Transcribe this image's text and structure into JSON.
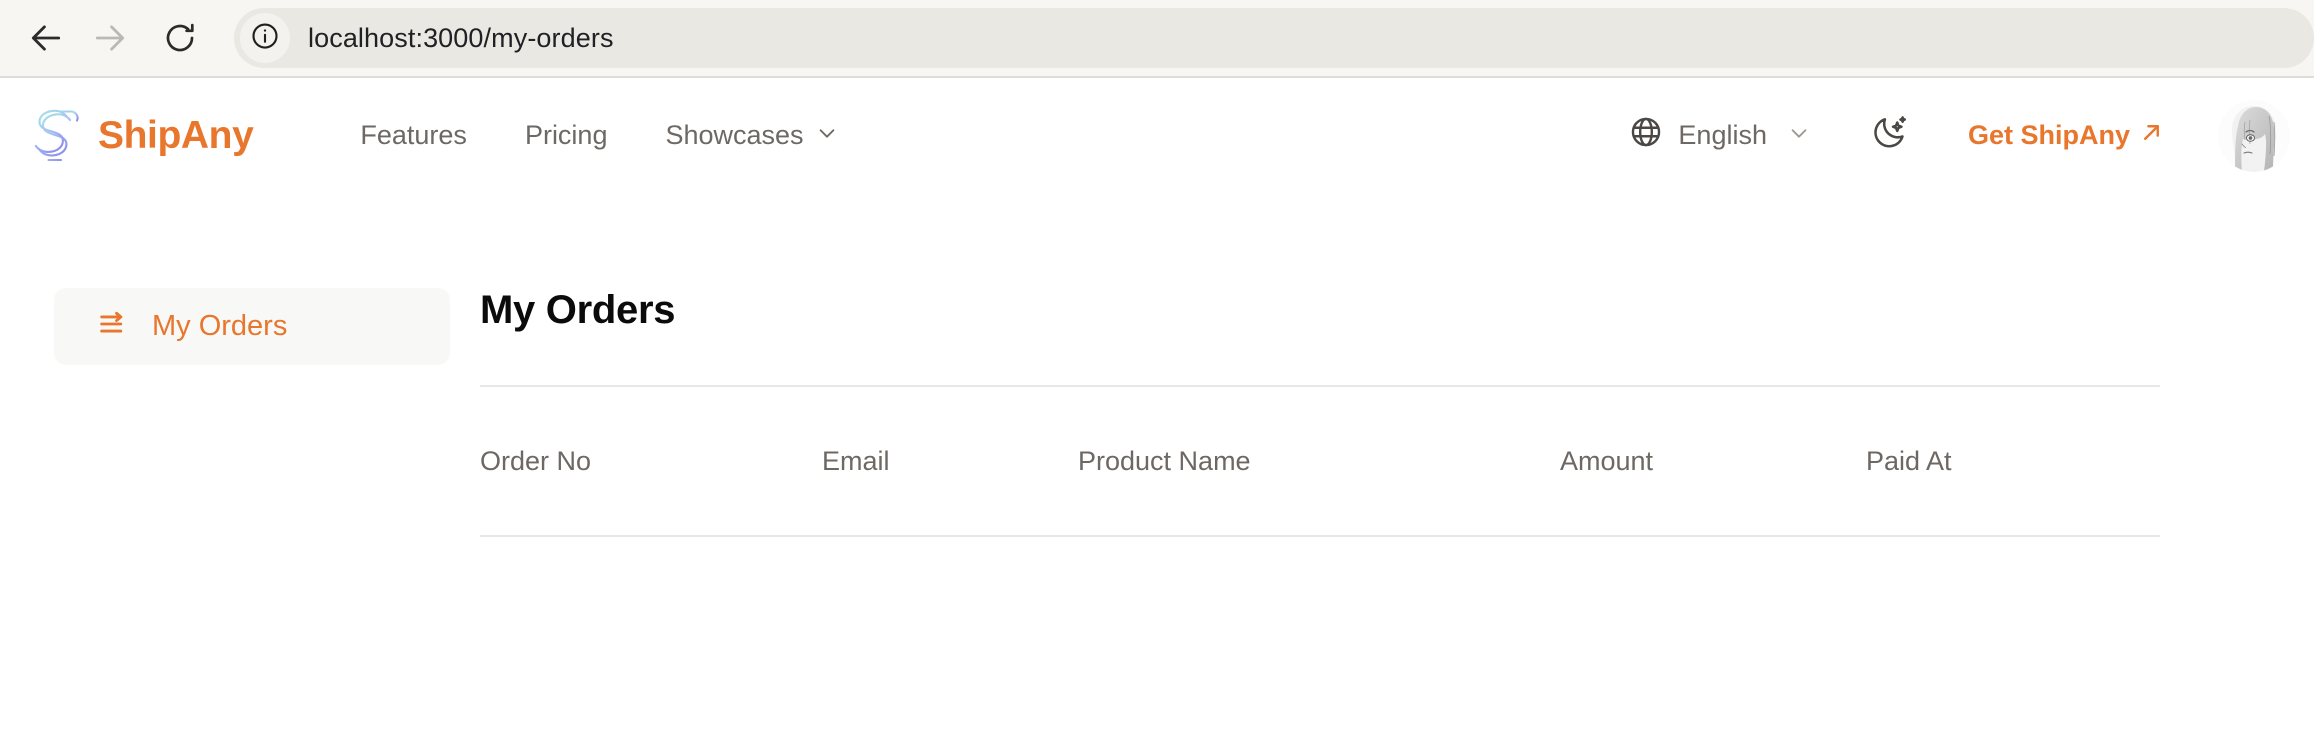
{
  "browser": {
    "back_icon": "arrow-left-icon",
    "forward_icon": "arrow-right-icon",
    "reload_icon": "reload-icon",
    "site_info_icon": "info-circle-icon",
    "url": "localhost:3000/my-orders",
    "url_placeholder": "Search or type a URL"
  },
  "header": {
    "logo_icon": "shipany-s-logo",
    "brand": "ShipAny",
    "nav": [
      {
        "label": "Features",
        "has_caret": false
      },
      {
        "label": "Pricing",
        "has_caret": false
      },
      {
        "label": "Showcases",
        "has_caret": true
      }
    ],
    "language": {
      "icon": "globe-icon",
      "label": "English",
      "caret_icon": "chevron-down-icon"
    },
    "theme_toggle_icon": "moon-sparkle-icon",
    "cta": {
      "label": "Get ShipAny",
      "icon": "arrow-up-right-icon"
    },
    "avatar": "user-avatar"
  },
  "sidebar": {
    "items": [
      {
        "label": "My Orders",
        "icon": "list-arrow-icon",
        "active": true
      }
    ]
  },
  "main": {
    "title": "My Orders",
    "table": {
      "columns": [
        "Order No",
        "Email",
        "Product Name",
        "Amount",
        "Paid At"
      ],
      "rows": []
    }
  },
  "colors": {
    "brand_orange": "#e8762c",
    "text_muted": "#6d6864",
    "rule": "#e7e7e7",
    "sidebar_active_bg": "#f8f8f7",
    "chrome_bg": "#f7f6f2",
    "url_bg": "#e9e8e3"
  }
}
